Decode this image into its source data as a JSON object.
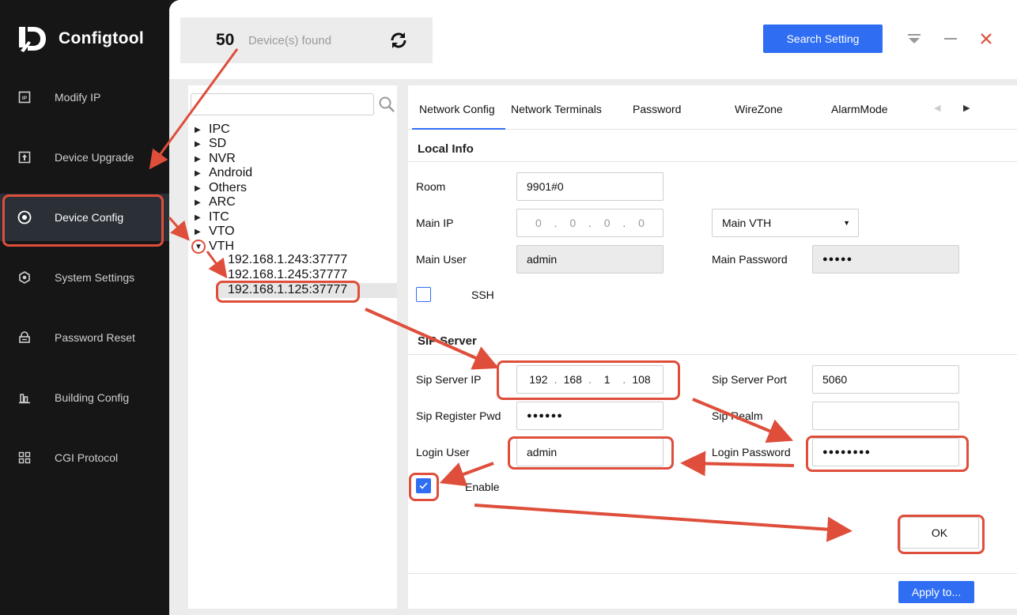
{
  "app": {
    "name": "Configtool"
  },
  "sidebar": {
    "items": [
      {
        "label": "Modify IP",
        "icon": "ip-icon"
      },
      {
        "label": "Device Upgrade",
        "icon": "upgrade-icon"
      },
      {
        "label": "Device Config",
        "icon": "target-icon",
        "active": true
      },
      {
        "label": "System Settings",
        "icon": "settings-icon"
      },
      {
        "label": "Password Reset",
        "icon": "lock-icon"
      },
      {
        "label": "Building Config",
        "icon": "building-icon"
      },
      {
        "label": "CGI Protocol",
        "icon": "grid-icon"
      }
    ]
  },
  "header": {
    "device_count": "50",
    "device_count_label": "Device(s) found",
    "search_setting_label": "Search Setting"
  },
  "tree": {
    "search_placeholder": "",
    "categories": [
      "IPC",
      "SD",
      "NVR",
      "Android",
      "Others",
      "ARC",
      "ITC",
      "VTO",
      "VTH"
    ],
    "vth_children": [
      "192.168.1.243:37777",
      "192.168.1.245:37777",
      "192.168.1.125:37777"
    ]
  },
  "tabs": [
    "Network Config",
    "Network Terminals",
    "Password",
    "WireZone",
    "AlarmMode"
  ],
  "local_info": {
    "title": "Local Info",
    "room_label": "Room",
    "room_value": "9901#0",
    "main_ip_label": "Main IP",
    "main_ip": [
      "0",
      "0",
      "0",
      "0"
    ],
    "main_vth_select": "Main VTH",
    "main_user_label": "Main User",
    "main_user_value": "admin",
    "main_password_label": "Main Password",
    "main_password_value": "●●●●●",
    "ssh_label": "SSH"
  },
  "sip_server": {
    "title": "SIP Server",
    "sip_server_ip_label": "Sip Server IP",
    "sip_server_ip": [
      "192",
      "168",
      "1",
      "108"
    ],
    "sip_server_port_label": "Sip Server Port",
    "sip_server_port_value": "5060",
    "sip_register_pwd_label": "Sip Register Pwd",
    "sip_register_pwd_value": "●●●●●●",
    "sip_realm_label": "Sip Realm",
    "sip_realm_value": "",
    "login_user_label": "Login User",
    "login_user_value": "admin",
    "login_password_label": "Login Password",
    "login_password_value": "●●●●●●●●",
    "enable_label": "Enable",
    "ok_label": "OK"
  },
  "footer": {
    "apply_label": "Apply to..."
  },
  "colors": {
    "accent": "#2f6ef2",
    "annotation": "#de4e3b",
    "sidebar_bg": "#161616"
  }
}
